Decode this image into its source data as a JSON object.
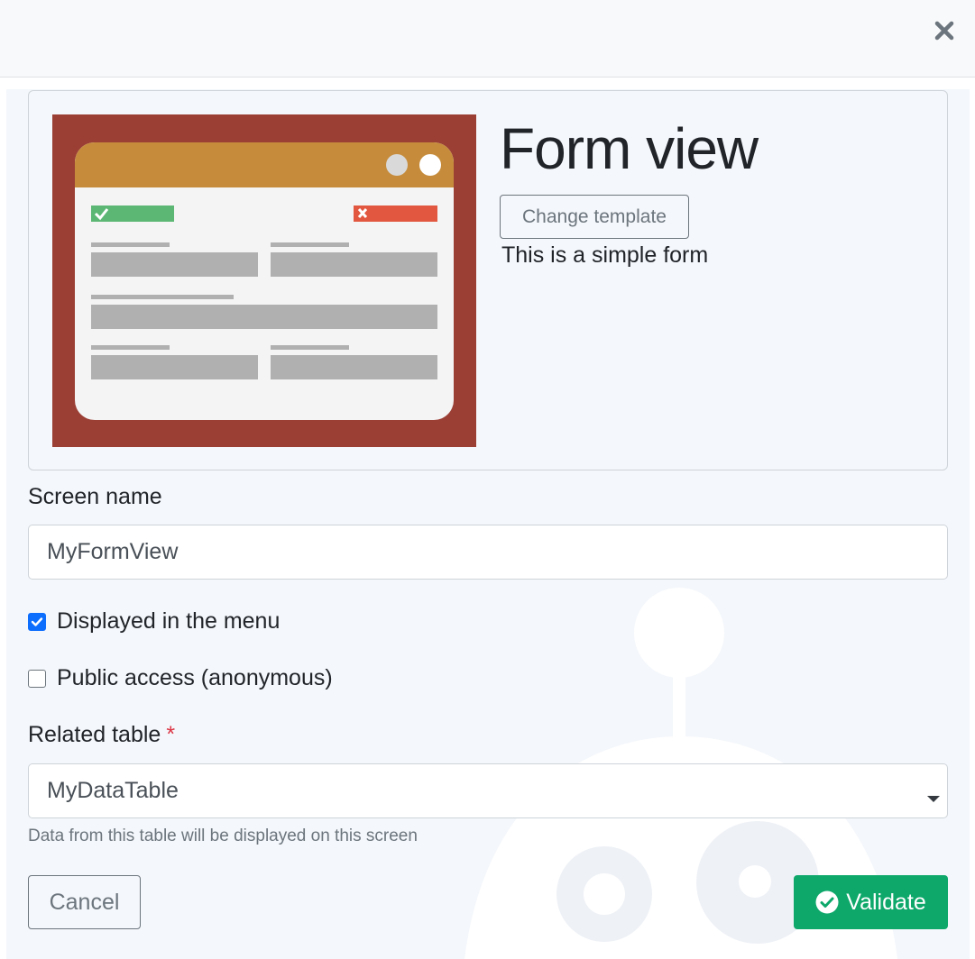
{
  "header": {
    "close_icon": "close-icon"
  },
  "template": {
    "title": "Form view",
    "change_button_label": "Change template",
    "description": "This is a simple form",
    "thumbnail_icon": "form-template-thumbnail",
    "colors": {
      "frame": "#9b3f35",
      "titlebar": "#c68c3c",
      "ok": "#5cb774",
      "cancel": "#e2573f"
    }
  },
  "screen_name": {
    "label": "Screen name",
    "value": "MyFormView"
  },
  "options": {
    "displayed_in_menu": {
      "label": "Displayed in the menu",
      "checked": true
    },
    "public_access": {
      "label": "Public access (anonymous)",
      "checked": false
    }
  },
  "related_table": {
    "label": "Related table",
    "required_mark": "*",
    "selected": "MyDataTable",
    "help": "Data from this table will be displayed on this screen"
  },
  "actions": {
    "cancel_label": "Cancel",
    "validate_label": "Validate",
    "validate_color": "#0ea86b"
  }
}
